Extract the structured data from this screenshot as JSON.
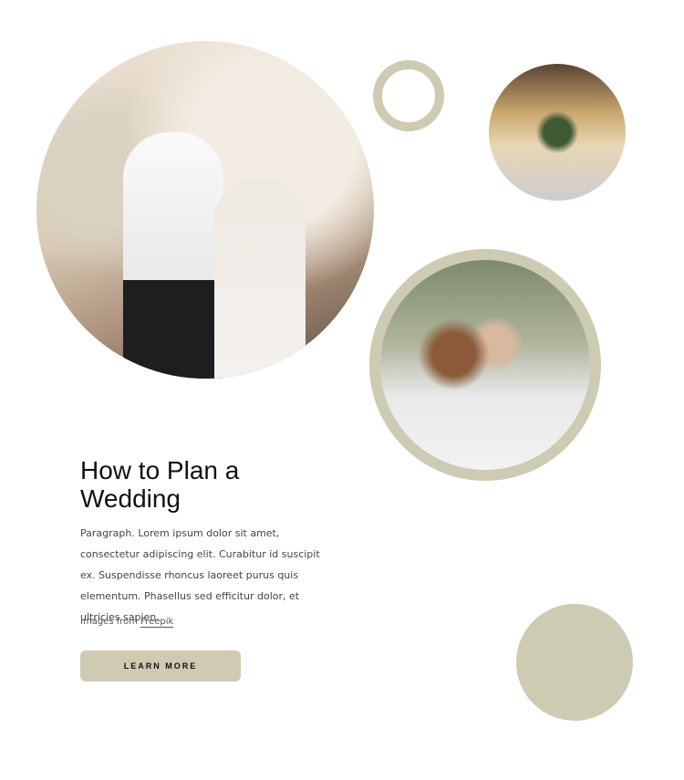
{
  "heading": "How to Plan a Wedding",
  "paragraph": "Paragraph. Lorem ipsum dolor sit amet, consectetur adipiscing elit. Curabitur id suscipit ex. Suspendisse rhoncus laoreet purus quis elementum. Phasellus sed efficitur dolor, et ultricies sapien.",
  "credit": {
    "prefix": "Images from ",
    "link": "Freepik"
  },
  "button": {
    "label": "LEARN MORE"
  },
  "colors": {
    "accent": "#cdcbb2"
  }
}
